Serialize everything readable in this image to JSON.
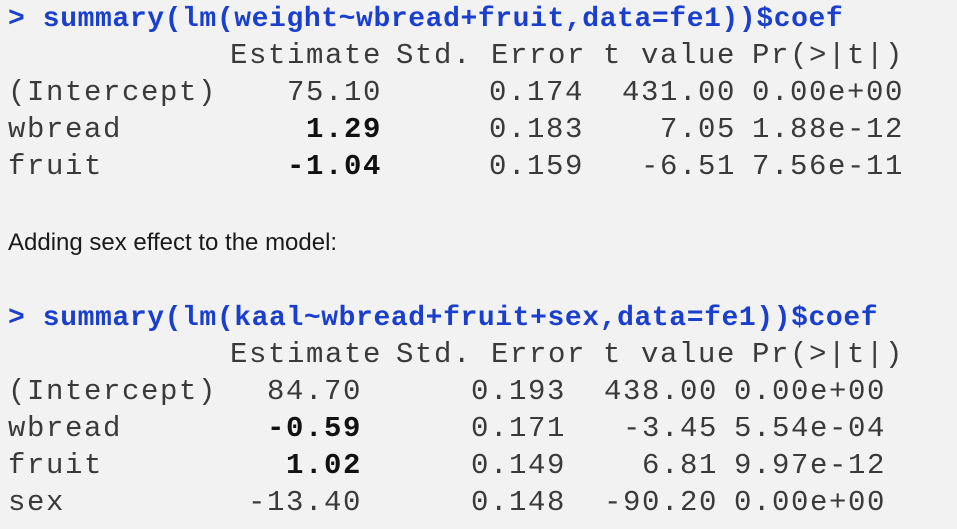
{
  "model1": {
    "command": "> summary(lm(weight~wbread+fruit,data=fe1))$coef",
    "headers": [
      "Estimate",
      "Std. Error",
      "t value",
      "Pr(>|t|)"
    ],
    "rows": [
      {
        "name": "(Intercept)",
        "estimate": "75.10",
        "estimate_bold": false,
        "se": "0.174",
        "t": "431.00",
        "p": "0.00e+00"
      },
      {
        "name": "wbread",
        "estimate": "1.29",
        "estimate_bold": true,
        "se": "0.183",
        "t": "7.05",
        "p": "1.88e-12"
      },
      {
        "name": "fruit",
        "estimate": "-1.04",
        "estimate_bold": true,
        "se": "0.159",
        "t": "-6.51",
        "p": "7.56e-11"
      }
    ]
  },
  "note": "Adding sex effect to the model:",
  "model2": {
    "command": "> summary(lm(kaal~wbread+fruit+sex,data=fe1))$coef",
    "headers": [
      "Estimate",
      "Std. Error",
      "t value",
      "Pr(>|t|)"
    ],
    "rows": [
      {
        "name": "(Intercept)",
        "estimate": "84.70",
        "estimate_bold": false,
        "se": "0.193",
        "t": "438.00",
        "p": "0.00e+00"
      },
      {
        "name": "wbread",
        "estimate": "-0.59",
        "estimate_bold": true,
        "se": "0.171",
        "t": "-3.45",
        "p": "5.54e-04"
      },
      {
        "name": "fruit",
        "estimate": "1.02",
        "estimate_bold": true,
        "se": "0.149",
        "t": "6.81",
        "p": "9.97e-12"
      },
      {
        "name": "sex",
        "estimate": "-13.40",
        "estimate_bold": false,
        "se": "0.148",
        "t": "-90.20",
        "p": "0.00e+00"
      }
    ]
  },
  "colors": {
    "command": "#1a3fcf",
    "output": "#3a3a3a",
    "background": "#f2f2f2"
  }
}
